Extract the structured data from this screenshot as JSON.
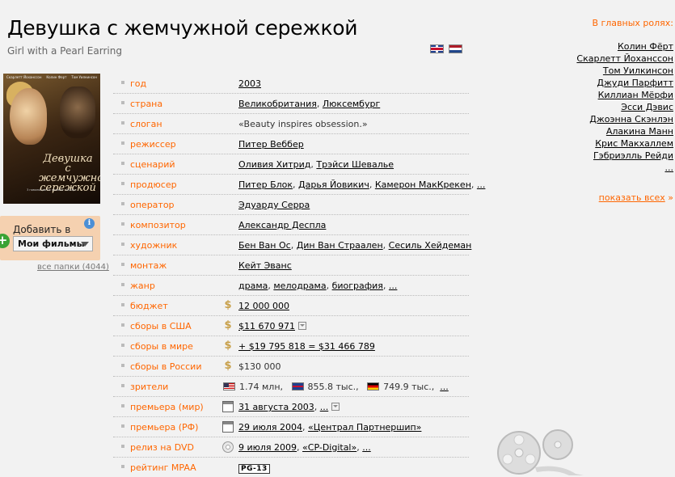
{
  "movie": {
    "title": "Девушка с жемчужной сережкой",
    "original_title": "Girl with a Pearl Earring"
  },
  "poster": {
    "actor_left": "Скарлетт Йоханссон",
    "actor_mid": "Колин Ферт",
    "actor_right": "Том Уилкинсон",
    "title": "Девушка с жемчужной сережкой",
    "tagline": "3 номинации на премию «Оскар»"
  },
  "add_box": {
    "label": "Добавить в",
    "selected": "Мои фильмы",
    "all_folders": "все папки (4044)"
  },
  "info": {
    "year": {
      "label": "год",
      "value": "2003"
    },
    "country": {
      "label": "страна",
      "values": [
        "Великобритания",
        "Люксембург"
      ]
    },
    "slogan": {
      "label": "слоган",
      "value": "«Beauty inspires obsession.»"
    },
    "director": {
      "label": "режиссер",
      "value": "Питер Веббер"
    },
    "writer": {
      "label": "сценарий",
      "values": [
        "Оливия Хитрид",
        "Трэйси Шевалье"
      ]
    },
    "producer": {
      "label": "продюсер",
      "values": [
        "Питер Блок",
        "Дарья Йовикич",
        "Камерон МакКрекен"
      ],
      "more": "..."
    },
    "operator": {
      "label": "оператор",
      "value": "Эдуарду Серра"
    },
    "composer": {
      "label": "композитор",
      "value": "Александр Деспла"
    },
    "artist": {
      "label": "художник",
      "values": [
        "Бен Ван Ос",
        "Дин Ван Страален",
        "Сесиль Хейдеман"
      ]
    },
    "editing": {
      "label": "монтаж",
      "value": "Кейт Эванс"
    },
    "genre": {
      "label": "жанр",
      "values": [
        "драма",
        "мелодрама",
        "биография"
      ],
      "more": "..."
    },
    "budget": {
      "label": "бюджет",
      "value": "12 000 000"
    },
    "usa_gross": {
      "label": "сборы в США",
      "value": "$11 670 971"
    },
    "world_gross": {
      "label": "сборы в мире",
      "value": "+ $19 795 818 = $31 466 789"
    },
    "russia_gross": {
      "label": "сборы в России",
      "value": "$130 000"
    },
    "viewers": {
      "label": "зрители",
      "us": "1.74 млн,",
      "uk": "855.8 тыс.,",
      "de": "749.9 тыс.,",
      "more": "..."
    },
    "premiere_world": {
      "label": "премьера (мир)",
      "value": "31 августа 2003",
      "more": "..."
    },
    "premiere_rf": {
      "label": "премьера (РФ)",
      "value": "29 июля 2004",
      "distributor": "«Централ Партнершип»"
    },
    "dvd": {
      "label": "релиз на DVD",
      "value": "9 июля 2009",
      "distributor": "«CP-Digital»",
      "more": "..."
    },
    "mpaa": {
      "label": "рейтинг MPAA",
      "value": "PG-13"
    }
  },
  "cast": {
    "heading": "В главных ролях:",
    "actors": [
      "Колин Фёрт",
      "Скарлетт Йоханссон",
      "Том Уилкинсон",
      "Джуди Парфитт",
      "Киллиан Мёрфи",
      "Эсси Дэвис",
      "Джоэнна Скэнлэн",
      "Алакина Манн",
      "Крис Макхаллем",
      "Гэбриэлль Рейди"
    ],
    "more": "...",
    "show_all": "показать всех",
    "show_all_arrow": "»"
  },
  "icons": {
    "flag_uk": "uk-flag-icon",
    "flag_nl": "nl-flag-icon",
    "dollar": "dollar-icon",
    "calendar": "calendar-icon",
    "dvd": "disc-icon",
    "film_reel": "film-reel-icon"
  },
  "colors": {
    "accent": "#ff6600",
    "background": "#f2f2f2",
    "link": "#000000"
  }
}
